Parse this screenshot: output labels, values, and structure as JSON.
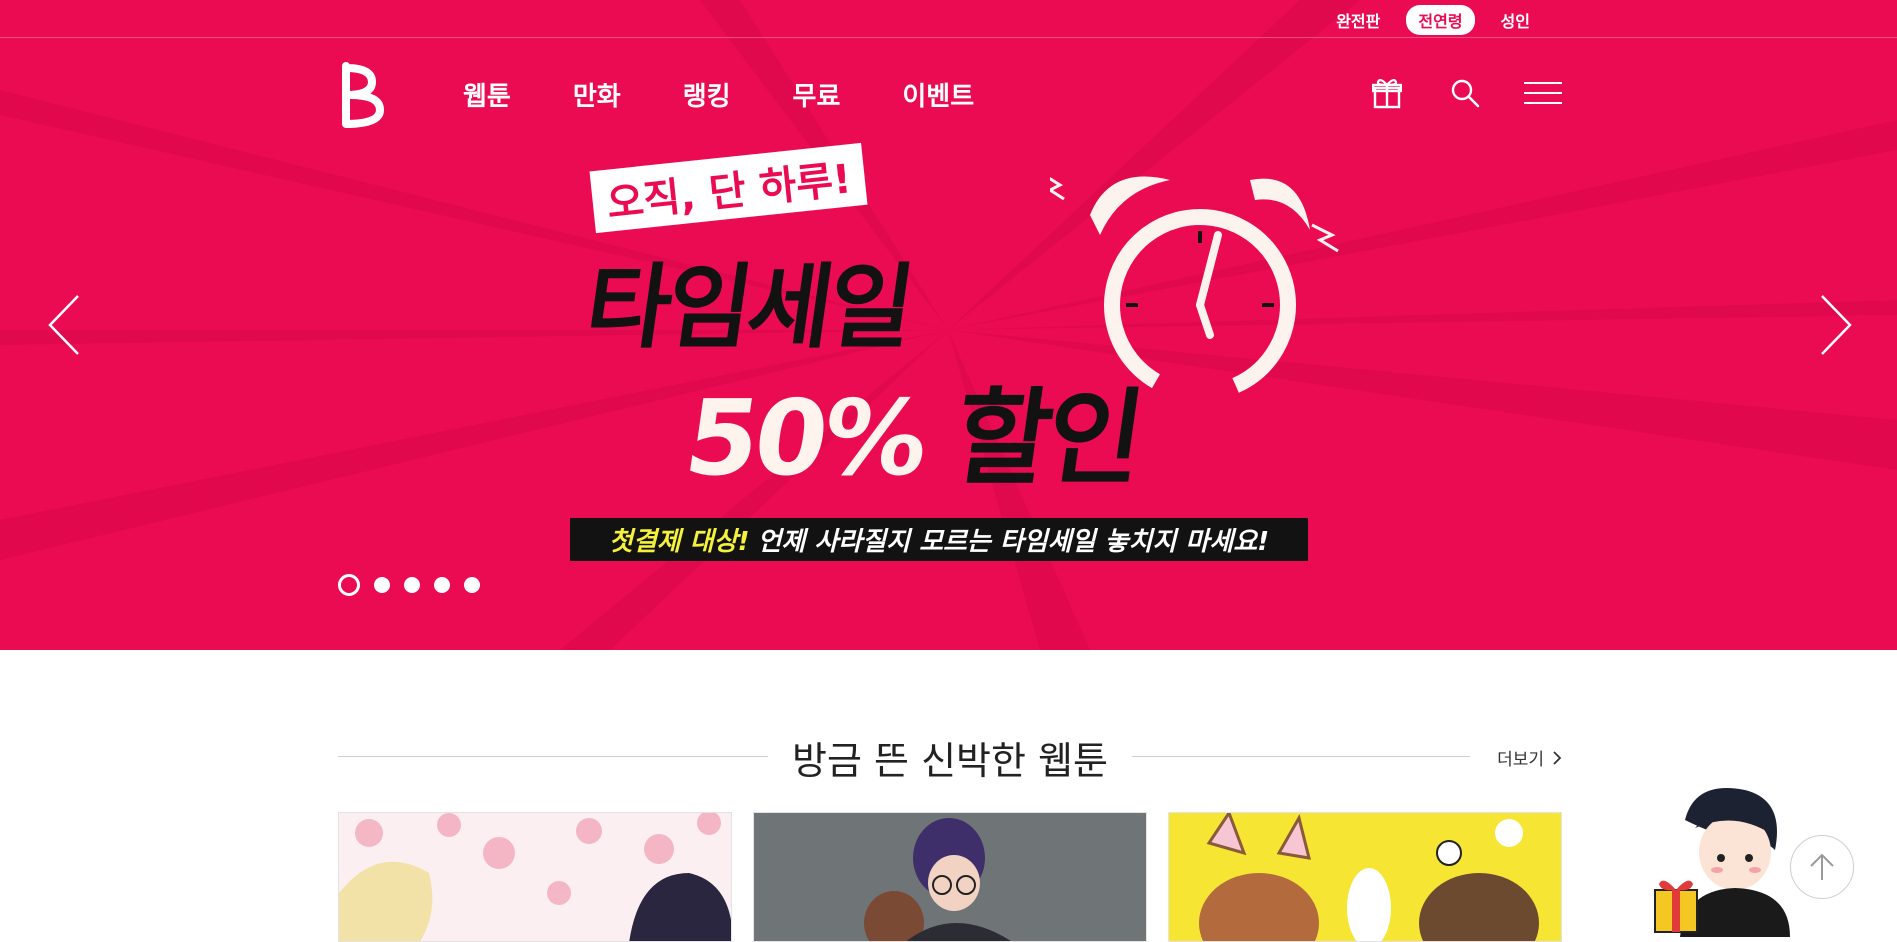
{
  "age_filter": {
    "items": [
      "완전판",
      "전연령",
      "성인"
    ],
    "active_index": 1
  },
  "nav": {
    "items": [
      "웹툰",
      "만화",
      "랭킹",
      "무료",
      "이벤트"
    ]
  },
  "utility_icons": [
    "gift-icon",
    "search-icon",
    "hamburger-menu-icon"
  ],
  "banner": {
    "tag": "오직, 단 하루!",
    "title": "타임세일",
    "sale_percent": "50%",
    "sale_word": "할인",
    "notice_highlight": "첫결제 대상!",
    "notice_rest": "언제 사라질지 모르는 타임세일 놓치지 마세요!",
    "background_color": "#eb0b52",
    "slide_count": 5,
    "active_slide": 1
  },
  "section": {
    "title": "방금 뜬 신박한 웹툰",
    "more_label": "더보기"
  },
  "colors": {
    "brand": "#eb0b52",
    "notice_highlight": "#f4f23a"
  }
}
